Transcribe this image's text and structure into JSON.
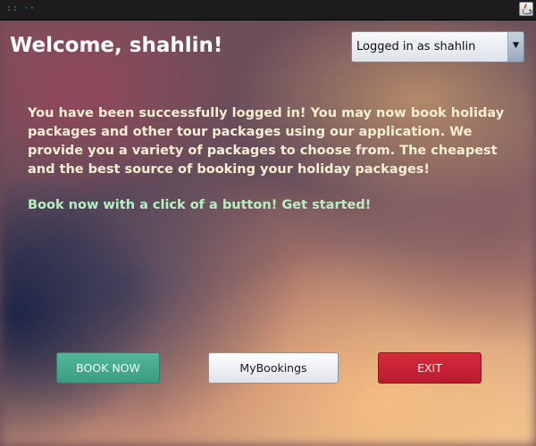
{
  "titlebar": {
    "left_glyph_1": "::",
    "left_glyph_2": "··",
    "app_icon": "java-icon"
  },
  "header": {
    "welcome": "Welcome, shahlin!"
  },
  "user_select": {
    "selected": "Logged in as shahlin",
    "arrow": "▼"
  },
  "main": {
    "intro": "You have been successfully logged in! You may now book holiday packages and other tour packages using our application. We provide you a variety of packages to choose from. The cheapest and the best source of booking your holiday packages!",
    "cta": "Book now with a click of a button! Get started!"
  },
  "buttons": {
    "book_now": "BOOK NOW",
    "my_bookings": "MyBookings",
    "exit": "EXIT"
  },
  "colors": {
    "book_now": "#3fa487",
    "exit": "#c8223a",
    "intro_text": "#f6efd2",
    "cta_text": "#b7f0c0"
  }
}
